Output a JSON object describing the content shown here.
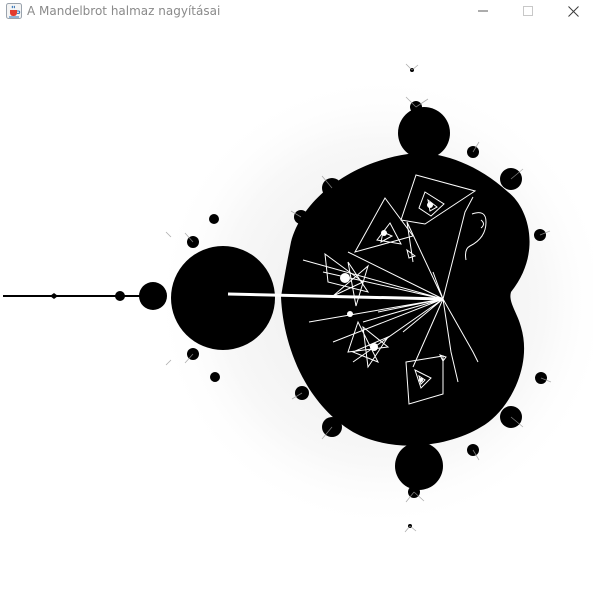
{
  "window": {
    "title": "A Mandelbrot halmaz nagyításai",
    "icons": {
      "app": "java-cup-icon",
      "minimize": "minimize-icon",
      "maximize": "maximize-icon",
      "close": "close-icon"
    }
  },
  "canvas": {
    "description_icon": "mandelbrot-fractal",
    "set_color": "#000000",
    "background_color": "#ffffff",
    "orbit_color": "#ffffff"
  }
}
